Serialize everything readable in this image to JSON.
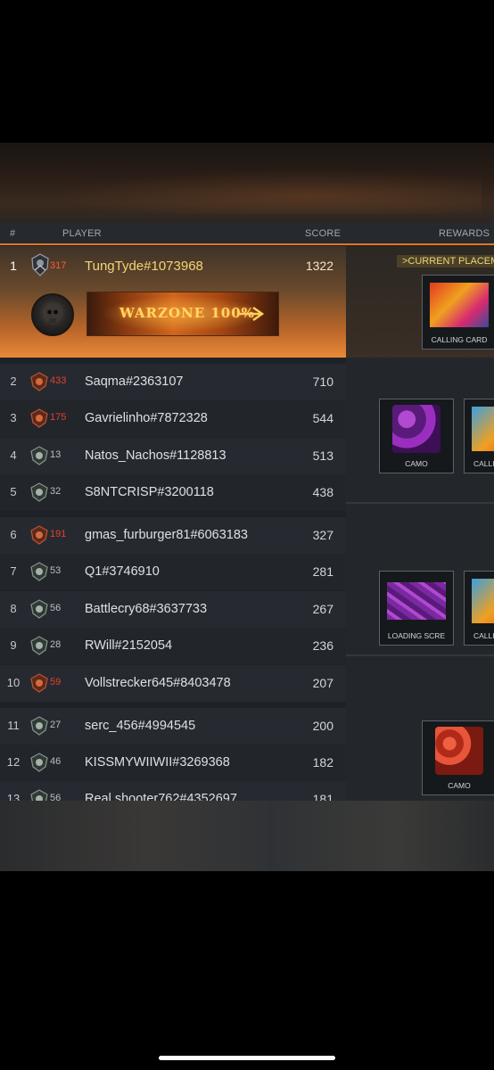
{
  "header": {
    "rank_label": "#",
    "player_label": "PLAYER",
    "score_label": "SCORE",
    "rewards_label": "REWARDS"
  },
  "first": {
    "rank": "1",
    "level": "317",
    "name": "TungTyde#1073968",
    "score": "1322",
    "card_text": "WARZONE 100%",
    "current_label": ">CURRENT PLACEM"
  },
  "rows": [
    {
      "rank": "2",
      "level": "433",
      "name": "Saqma#2363107",
      "score": "710",
      "level_color": "red"
    },
    {
      "rank": "3",
      "level": "175",
      "name": "Gavrielinho#7872328",
      "score": "544",
      "level_color": "red"
    },
    {
      "rank": "4",
      "level": "13",
      "name": "Natos_Nachos#1128813",
      "score": "513",
      "level_color": "gray"
    },
    {
      "rank": "5",
      "level": "32",
      "name": "S8NTCRISP#3200118",
      "score": "438",
      "level_color": "gray"
    },
    {
      "rank": "6",
      "level": "191",
      "name": "gmas_furburger81#6063183",
      "score": "327",
      "level_color": "red"
    },
    {
      "rank": "7",
      "level": "53",
      "name": "Q1#3746910",
      "score": "281",
      "level_color": "gray"
    },
    {
      "rank": "8",
      "level": "56",
      "name": "Battlecry68#3637733",
      "score": "267",
      "level_color": "gray"
    },
    {
      "rank": "9",
      "level": "28",
      "name": "RWill#2152054",
      "score": "236",
      "level_color": "gray"
    },
    {
      "rank": "10",
      "level": "59",
      "name": "Vollstrecker645#8403478",
      "score": "207",
      "level_color": "red"
    },
    {
      "rank": "11",
      "level": "27",
      "name": "serc_456#4994545",
      "score": "200",
      "level_color": "gray"
    },
    {
      "rank": "12",
      "level": "46",
      "name": "KISSMYWIIWII#3269368",
      "score": "182",
      "level_color": "gray"
    },
    {
      "rank": "13",
      "level": "56",
      "name": "Real shooter762#4352697",
      "score": "181",
      "level_color": "gray"
    }
  ],
  "rewards": {
    "first_calling_card": "CALLING CARD",
    "group2_camo": "CAMO",
    "group2_calling": "CALLI",
    "group3_loading": "LOADING SCRE",
    "group3_calling": "CALLI",
    "group4_camo": "CAMO"
  },
  "colors": {
    "accent_orange": "#e8731f",
    "gold_text": "#f2d575",
    "level_red": "#e2412b"
  }
}
